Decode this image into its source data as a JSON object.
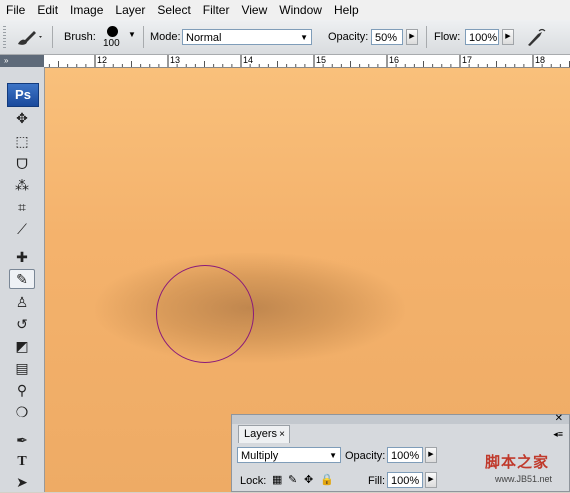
{
  "menu": [
    "File",
    "Edit",
    "Image",
    "Layer",
    "Select",
    "Filter",
    "View",
    "Window",
    "Help"
  ],
  "options_bar": {
    "brush_label": "Brush:",
    "brush_size": "100",
    "mode_label": "Mode:",
    "mode_value": "Normal",
    "opacity_label": "Opacity:",
    "opacity_value": "50%",
    "flow_label": "Flow:",
    "flow_value": "100%"
  },
  "toolbox": {
    "logo": "Ps",
    "tools": [
      {
        "name": "move-tool",
        "glyph": "✥"
      },
      {
        "name": "marquee-tool",
        "glyph": "⬚"
      },
      {
        "name": "lasso-tool",
        "glyph": "ᗜ"
      },
      {
        "name": "magic-wand-tool",
        "glyph": "⁂"
      },
      {
        "name": "crop-tool",
        "glyph": "⌗"
      },
      {
        "name": "eyedropper-tool",
        "glyph": "⟋"
      },
      {
        "name": "healing-brush-tool",
        "glyph": "✚"
      },
      {
        "name": "brush-tool",
        "glyph": "✎"
      },
      {
        "name": "clone-stamp-tool",
        "glyph": "♙"
      },
      {
        "name": "history-brush-tool",
        "glyph": "↺"
      },
      {
        "name": "eraser-tool",
        "glyph": "◩"
      },
      {
        "name": "gradient-tool",
        "glyph": "▤"
      },
      {
        "name": "dodge-tool",
        "glyph": "⚲"
      },
      {
        "name": "blur-tool",
        "glyph": "❍"
      },
      {
        "name": "pen-tool",
        "glyph": "✒"
      },
      {
        "name": "type-tool",
        "glyph": "T"
      },
      {
        "name": "path-selection-tool",
        "glyph": "➤"
      }
    ],
    "active_tool": "brush-tool"
  },
  "ruler": {
    "numbers": [
      "12",
      "13",
      "14",
      "15",
      "16",
      "17",
      "18"
    ]
  },
  "layers_panel": {
    "tab_label": "Layers",
    "blend_mode": "Multiply",
    "opacity_label": "Opacity:",
    "opacity_value": "100%",
    "lock_label": "Lock:",
    "fill_label": "Fill:",
    "fill_value": "100%"
  },
  "watermark": {
    "main": "脚本之家",
    "sub": "www.JB51.net"
  },
  "colors": {
    "canvas_top": "#f9c07b",
    "canvas_bottom": "#eeab65",
    "brush_cursor": "#8a1a7a",
    "ps_logo": "#2a5caf"
  }
}
